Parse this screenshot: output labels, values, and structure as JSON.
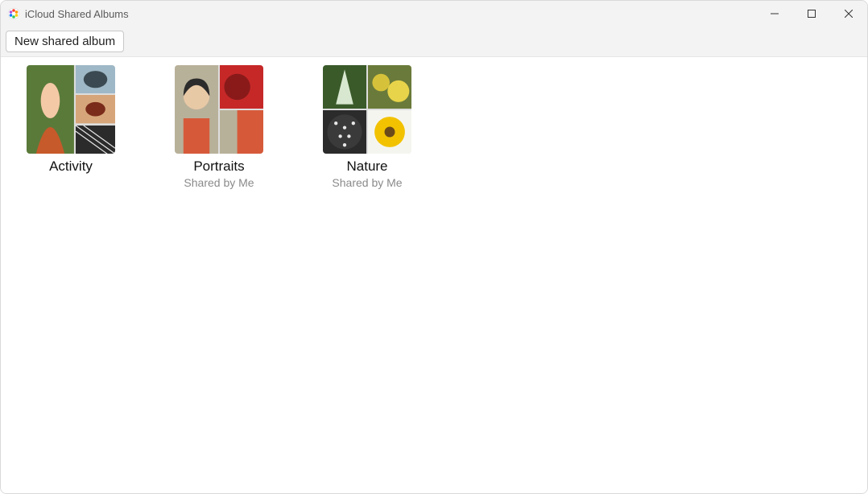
{
  "titlebar": {
    "title": "iCloud Shared Albums"
  },
  "toolbar": {
    "new_shared_album_label": "New shared album"
  },
  "albums": [
    {
      "title": "Activity",
      "subtitle": ""
    },
    {
      "title": "Portraits",
      "subtitle": "Shared by Me"
    },
    {
      "title": "Nature",
      "subtitle": "Shared by Me"
    }
  ]
}
